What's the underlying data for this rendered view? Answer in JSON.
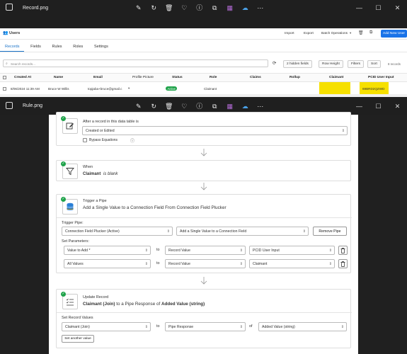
{
  "window1": {
    "title": "Record.png"
  },
  "window2": {
    "title": "Rule.png"
  },
  "toolbar_icons": [
    "edit-icon",
    "rotate-icon",
    "trash-icon",
    "heart-icon",
    "info-icon",
    "crop-icon",
    "film-icon",
    "cloud-off-icon",
    "more-icon"
  ],
  "record_app": {
    "section": "Users",
    "actions": {
      "import": "Import",
      "export": "Export",
      "batch": "Batch Operations",
      "add": "Add New User"
    },
    "tabs": [
      "Records",
      "Fields",
      "Rules",
      "Roles",
      "Settings"
    ],
    "search": {
      "placeholder": "Search records..."
    },
    "filters": {
      "hidden": "2 hidden fields",
      "row_height": "Row Height",
      "filters": "Filters",
      "sort": "Sort",
      "count": "8 records"
    },
    "columns": [
      "Created At",
      "Name",
      "Email",
      "Profile Picture",
      "Status",
      "Role",
      "Claims",
      "Rollup",
      "Claimant",
      "PCID User Input"
    ],
    "row": {
      "created": "8/06/2024 11:39 AM",
      "name": "Bruce W Willis",
      "email": "topjaba+bruce@gmail.c",
      "status": "Active",
      "role": "Claimant",
      "pcid": "69BRD2QZWD"
    },
    "highlight_color": "#f6e000"
  },
  "rule_app": {
    "trigger_card": {
      "text": "After a record in this data table is",
      "value": "Created or Edited",
      "bypass": "Bypass Equations"
    },
    "when_card": {
      "title": "When",
      "field": "Claimant",
      "condition": "is blank"
    },
    "pipe_card": {
      "title": "Trigger a Pipe",
      "subtitle": "Add a Single Value to a Connection Field From Connection Field Plucker",
      "trigger_pipe_label": "Trigger Pipe:",
      "pipe_select": "Connection Field Plucker (Active)",
      "action_select": "Add a Single Value to a Connection Field",
      "remove_btn": "Remove Pipe",
      "params_label": "Set Parameters:",
      "params": [
        {
          "from": "Value to Add *",
          "to": "to",
          "type": "Record Value",
          "value": "PCID User Input"
        },
        {
          "from": "All Values",
          "to": "to",
          "type": "Record Value",
          "value": "Claimant"
        }
      ]
    },
    "update_card": {
      "title": "Update Record",
      "desc_field": "Claimant (Join)",
      "desc_mid": "to a Pipe Response of",
      "desc_value": "Added Value (string)",
      "values_label": "Set Record Values",
      "field": "Claimant (Join)",
      "to": "to",
      "type": "Pipe Response",
      "of": "of",
      "value": "Added Value (string)",
      "another_btn": "Set another value"
    }
  }
}
